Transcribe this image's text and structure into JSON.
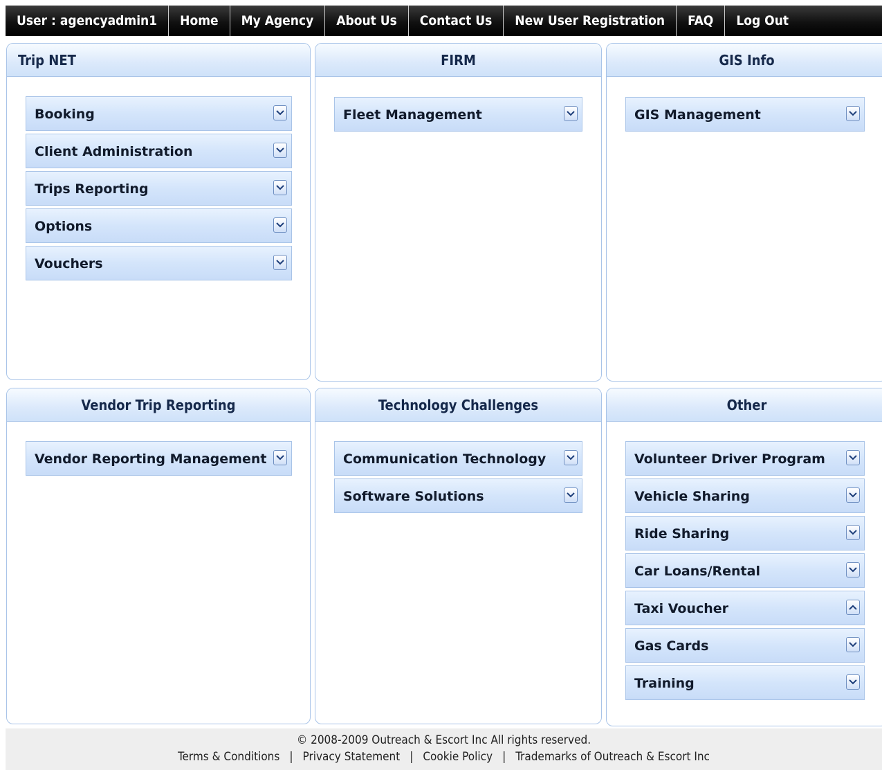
{
  "nav": {
    "user": "User : agencyadmin1",
    "items": [
      "Home",
      "My Agency",
      "About Us",
      "Contact Us",
      "New User Registration",
      "FAQ",
      "Log Out"
    ]
  },
  "panels": {
    "trip_net": {
      "title": "Trip NET",
      "items": [
        "Booking",
        "Client Administration",
        "Trips Reporting",
        "Options",
        "Vouchers"
      ]
    },
    "firm": {
      "title": "FIRM",
      "items": [
        "Fleet Management"
      ]
    },
    "gis_info": {
      "title": "GIS Info",
      "items": [
        "GIS Management"
      ]
    },
    "vendor": {
      "title": "Vendor Trip Reporting",
      "items": [
        "Vendor Reporting Management"
      ]
    },
    "tech": {
      "title": "Technology Challenges",
      "items": [
        "Communication Technology",
        "Software Solutions"
      ]
    },
    "other": {
      "title": "Other",
      "items": [
        "Volunteer Driver Program",
        "Vehicle Sharing",
        "Ride Sharing",
        "Car Loans/Rental",
        "Taxi Voucher",
        "Gas Cards",
        "Training"
      ]
    }
  },
  "footer": {
    "copyright": "© 2008-2009 Outreach & Escort Inc All rights reserved.",
    "links": [
      "Terms & Conditions",
      "Privacy Statement",
      "Cookie Policy",
      "Trademarks of Outreach & Escort Inc"
    ],
    "separator": "|"
  },
  "colors": {
    "nav_bg": "#000000",
    "panel_border": "#a9c4e8",
    "header_bg": "#dbe9fb",
    "item_bg": "#d4e5fb"
  },
  "icons": {
    "dropdown": "chevron-down-icon",
    "dropdown_open": "chevron-up-icon"
  }
}
